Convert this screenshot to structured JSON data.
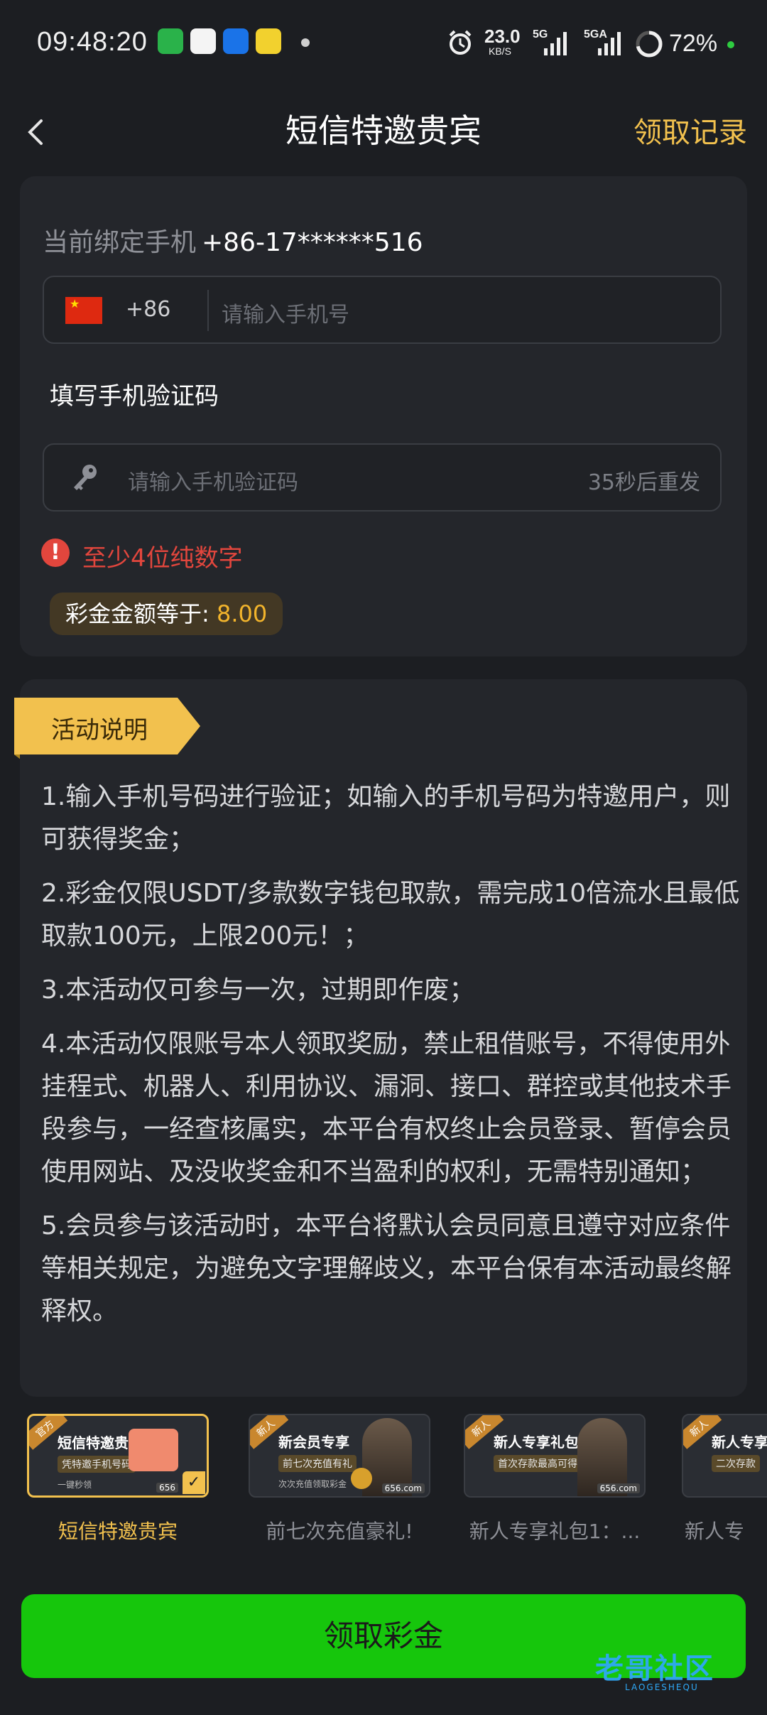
{
  "status_bar": {
    "time": "09:48:20",
    "net_speed": "23.0",
    "net_unit": "KB/S",
    "sig1": "5G",
    "sig2": "5GA",
    "battery": "72%",
    "app_icons": [
      "wechat-icon",
      "qq-icon",
      "alipay-icon",
      "bianbian-icon"
    ]
  },
  "nav": {
    "title": "短信特邀贵宾",
    "right": "领取记录"
  },
  "bind": {
    "label": "当前绑定手机",
    "number": "+86-17******516"
  },
  "phone": {
    "country_code": "+86",
    "placeholder": "请输入手机号"
  },
  "code": {
    "label": "填写手机验证码",
    "placeholder": "请输入手机验证码",
    "resend": "35秒后重发"
  },
  "error": "至少4位纯数字",
  "bonus": {
    "label": "彩金金额等于:",
    "value": "8.00"
  },
  "activity": {
    "title": "活动说明",
    "rules": [
      "1.输入手机号码进行验证；如输入的手机号码为特邀用户，则可获得奖金；",
      "2.彩金仅限USDT/多款数字钱包取款，需完成10倍流水且最低取款100元，上限200元！；",
      "3.本活动仅可参与一次，过期即作废；",
      "4.本活动仅限账号本人领取奖励，禁止租借账号，不得使用外挂程式、机器人、利用协议、漏洞、接口、群控或其他技术手段参与，一经查核属实，本平台有权终止会员登录、暂停会员使用网站、及没收奖金和不当盈利的权利，无需特别通知；",
      "5.会员参与该活动时，本平台将默认会员同意且遵守对应条件等相关规定，为避免文字理解歧义，本平台保有本活动最终解释权。"
    ]
  },
  "promo_tabs": [
    {
      "label": "短信特邀贵宾",
      "tag": "官方",
      "thumb_title": "短信特邀贵宾",
      "thumb_sub": "凭特邀手机号码",
      "thumb_small": "一键秒领",
      "brand": "656",
      "active": true
    },
    {
      "label": "前七次充值豪礼!",
      "tag": "新人",
      "thumb_title": "新会员专享",
      "thumb_sub": "前七次充值有礼",
      "thumb_small": "次次充值领取彩金",
      "brand": "656.com",
      "active": false
    },
    {
      "label": "新人专享礼包1：...",
      "tag": "新人",
      "thumb_title": "新人专享礼包❶",
      "thumb_sub": "首次存款最高可得2656元",
      "thumb_small": "",
      "brand": "656.com",
      "active": false
    },
    {
      "label": "新人专",
      "tag": "新人",
      "thumb_title": "新人专享",
      "thumb_sub": "二次存款",
      "thumb_small": "",
      "brand": "",
      "active": false
    }
  ],
  "cta": "领取彩金",
  "watermark": {
    "text": "老哥社区",
    "sub": "LAOGESHEQU"
  },
  "colors": {
    "background": "#1c1e22",
    "card": "#24262b",
    "accent_gold": "#f2c14e",
    "error": "#e2463d",
    "cta": "#16c60c"
  }
}
